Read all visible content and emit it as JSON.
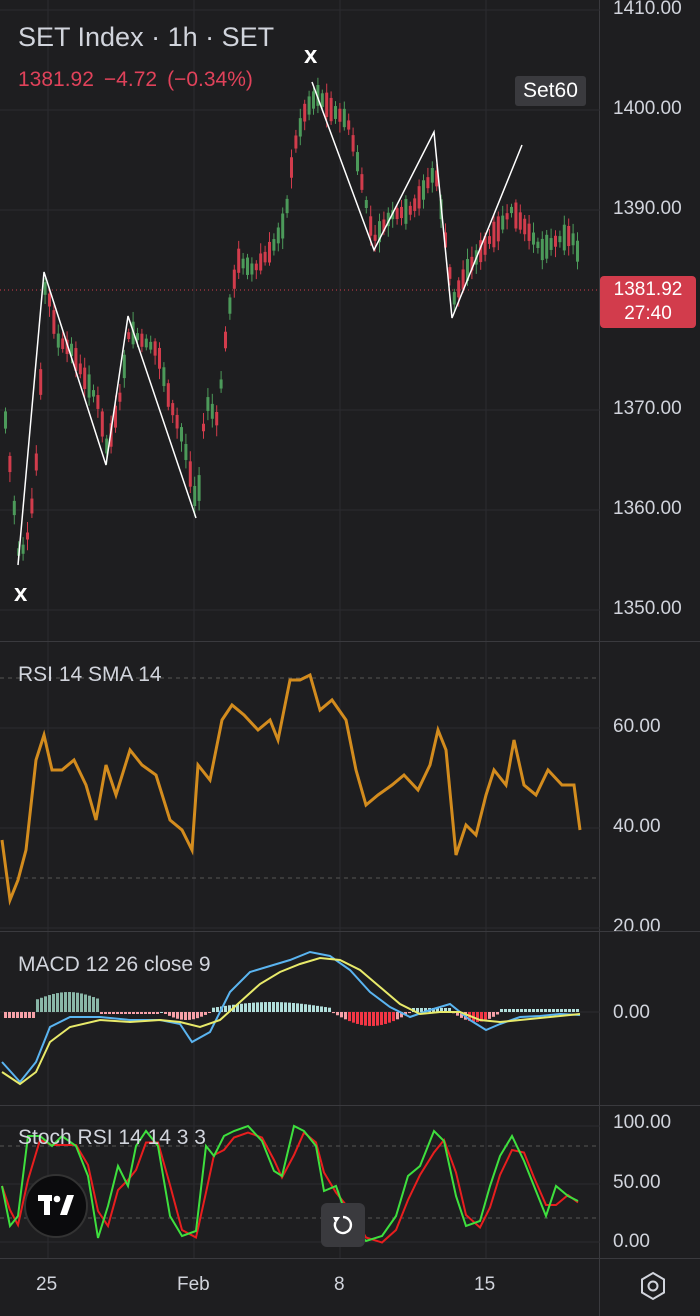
{
  "header": {
    "title": "SET Index · 1h · SET",
    "last": "1381.92",
    "change": "−4.72",
    "change_pct": "(−0.34%)",
    "symbol_badge": "Set60"
  },
  "price_tag": {
    "price": "1381.92",
    "countdown": "27:40"
  },
  "price_scale": [
    "1410.00",
    "1400.00",
    "1390.00",
    "1370.00",
    "1360.00",
    "1350.00"
  ],
  "pattern_markers": [
    "x",
    "x"
  ],
  "indicators": {
    "rsi": {
      "label": "RSI 14 SMA 14",
      "ticks": [
        "60.00",
        "40.00",
        "20.00"
      ]
    },
    "macd": {
      "label": "MACD 12 26 close 9",
      "ticks": [
        "0.00"
      ]
    },
    "stoch": {
      "label": "Stoch RSI 14 14 3 3",
      "ticks": [
        "100.00",
        "50.00",
        "0.00"
      ]
    }
  },
  "time_axis": [
    "25",
    "Feb",
    "8",
    "15"
  ],
  "colors": {
    "up": "#4c9a5a",
    "down": "#d23c4c",
    "rsi": "#d38c1e",
    "macd": "#5ab4f0",
    "signal": "#e8ea6a",
    "stoch_k": "#3ee03e",
    "stoch_d": "#e81e1e"
  },
  "icons": [
    "tradingview-logo-icon",
    "reset-chart-icon",
    "chart-settings-icon"
  ]
}
